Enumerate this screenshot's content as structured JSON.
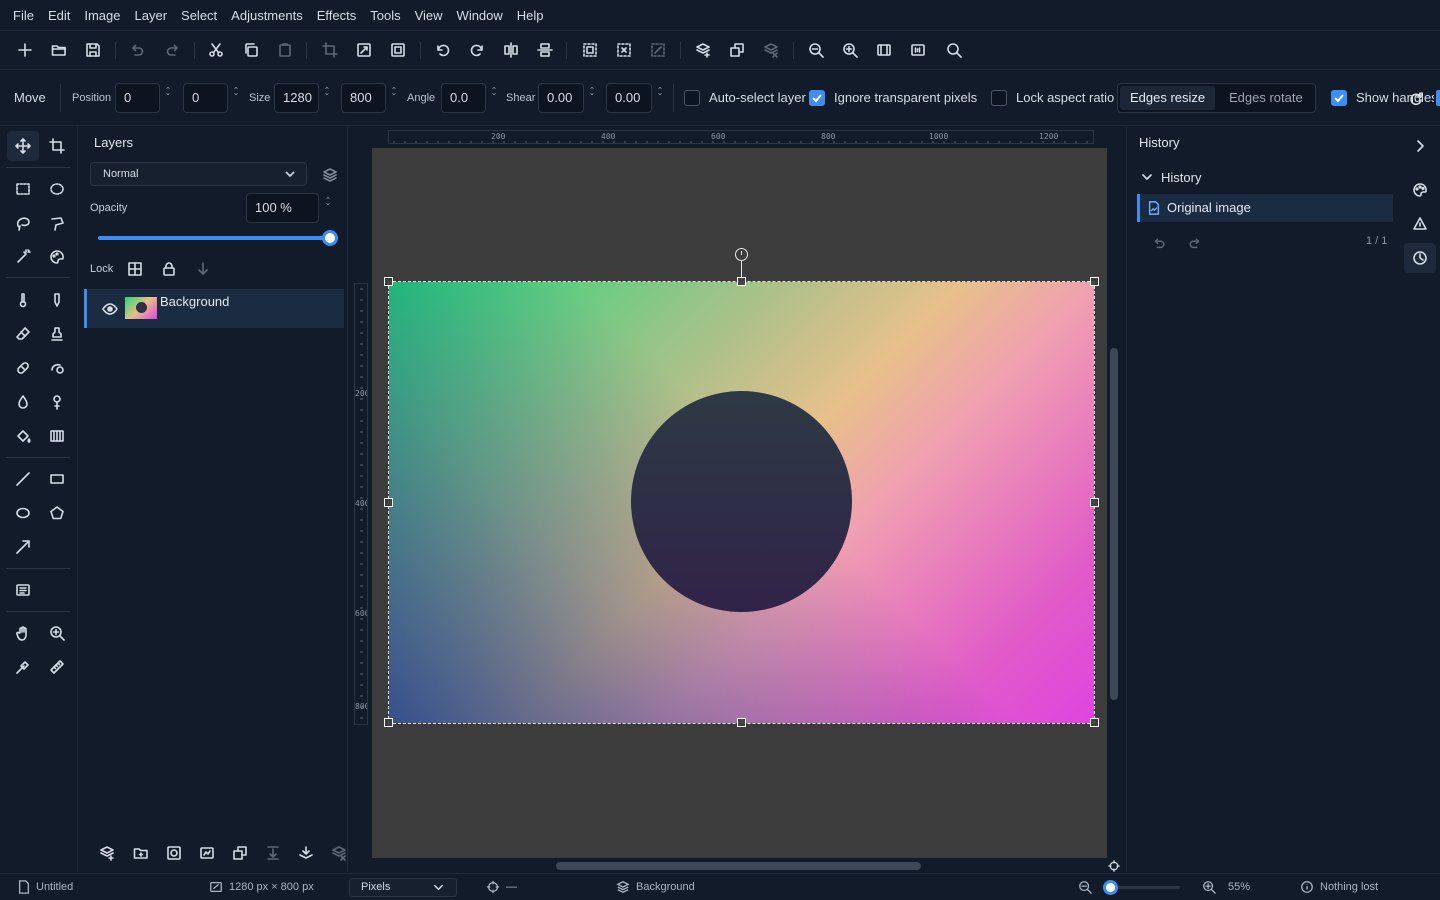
{
  "menu": [
    "File",
    "Edit",
    "Image",
    "Layer",
    "Select",
    "Adjustments",
    "Effects",
    "Tools",
    "View",
    "Window",
    "Help"
  ],
  "options": {
    "tool_name": "Move",
    "position_label": "Position",
    "pos_x": "0",
    "pos_y": "0",
    "size_label": "Size",
    "width": "1280",
    "height": "800",
    "angle_label": "Angle",
    "angle": "0.0",
    "shear_label": "Shear",
    "shear_x": "0.00",
    "shear_y": "0.00",
    "auto_select_label": "Auto-select layer",
    "auto_select_checked": false,
    "ignore_transparent_label": "Ignore transparent pixels",
    "ignore_transparent_checked": true,
    "lock_aspect_label": "Lock aspect ratio",
    "lock_aspect_checked": false,
    "edges_resize": "Edges resize",
    "edges_rotate": "Edges rotate",
    "show_handles_label": "Show handles",
    "show_handles_checked": true
  },
  "layers": {
    "title": "Layers",
    "blend_mode": "Normal",
    "opacity_label": "Opacity",
    "opacity_value": "100 %",
    "opacity_fraction": 1.0,
    "lock_label": "Lock",
    "items": [
      {
        "name": "Background",
        "visible": true,
        "selected": true
      }
    ]
  },
  "rulers": {
    "top": [
      "200",
      "400",
      "600",
      "800",
      "1000",
      "1200"
    ],
    "left": [
      "200",
      "400",
      "600",
      "800"
    ]
  },
  "history": {
    "title": "History",
    "section": "History",
    "items": [
      {
        "label": "Original image",
        "selected": true
      }
    ],
    "counter": "1 / 1"
  },
  "status": {
    "document": "Untitled",
    "image_size": "1280 px × 800 px",
    "units": "Pixels",
    "cursor": "—",
    "active_layer": "Background",
    "zoom": "55%",
    "zoom_fraction": 0.55,
    "saved_state": "Nothing lost"
  },
  "colors": {
    "accent": "#3d8ef0",
    "background": "#111b2a",
    "canvas_bg": "#3c3c3c"
  }
}
